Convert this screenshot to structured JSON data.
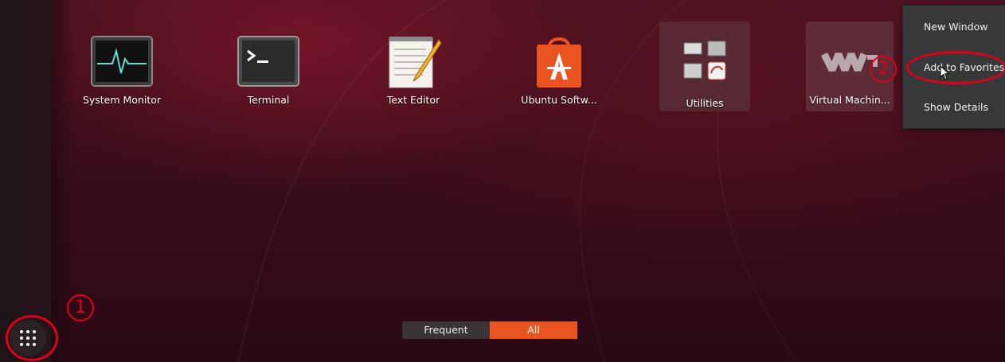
{
  "apps": [
    {
      "name": "system-monitor",
      "label": "System Monitor",
      "icon": "system-monitor-icon"
    },
    {
      "name": "terminal",
      "label": "Terminal",
      "icon": "terminal-icon"
    },
    {
      "name": "text-editor",
      "label": "Text Editor",
      "icon": "text-editor-icon"
    },
    {
      "name": "ubuntu-software",
      "label": "Ubuntu Softw...",
      "icon": "ubuntu-software-icon"
    },
    {
      "name": "utilities",
      "label": "Utilities",
      "icon": "utilities-folder-icon"
    },
    {
      "name": "virtual-machine",
      "label": "Virtual Machin...",
      "icon": "virtual-machine-icon"
    }
  ],
  "context_menu": {
    "items": [
      "New Window",
      "Add to Favorites",
      "Show Details"
    ]
  },
  "switcher": {
    "frequent": "Frequent",
    "all": "All"
  },
  "annotations": {
    "step1": "1",
    "step2": "2"
  },
  "colors": {
    "accent": "#e95420",
    "annotation": "#e0001a",
    "menu_bg": "#37383a"
  }
}
